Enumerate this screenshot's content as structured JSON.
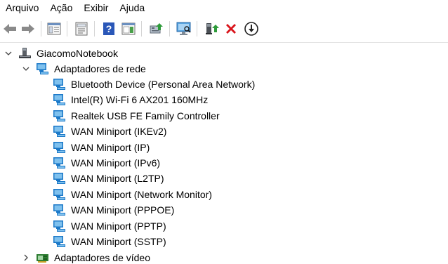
{
  "menu": {
    "items": [
      "Arquivo",
      "Ação",
      "Exibir",
      "Ajuda"
    ]
  },
  "toolbar": {
    "buttons": [
      {
        "icon": "back-arrow-icon"
      },
      {
        "icon": "forward-arrow-icon"
      },
      {
        "icon": "console-tree-icon"
      },
      {
        "icon": "properties-icon"
      },
      {
        "icon": "help-icon"
      },
      {
        "icon": "action-pane-icon"
      },
      {
        "icon": "update-driver-icon"
      },
      {
        "icon": "scan-hardware-icon"
      },
      {
        "icon": "enable-device-icon"
      },
      {
        "icon": "uninstall-device-icon"
      },
      {
        "icon": "download-icon"
      }
    ]
  },
  "tree": {
    "root": {
      "label": "GiacomoNotebook"
    },
    "category_network": {
      "label": "Adaptadores de rede"
    },
    "network_devices": [
      "Bluetooth Device (Personal Area Network)",
      "Intel(R) Wi-Fi 6 AX201 160MHz",
      "Realtek USB FE Family Controller",
      "WAN Miniport (IKEv2)",
      "WAN Miniport (IP)",
      "WAN Miniport (IPv6)",
      "WAN Miniport (L2TP)",
      "WAN Miniport (Network Monitor)",
      "WAN Miniport (PPPOE)",
      "WAN Miniport (PPTP)",
      "WAN Miniport (SSTP)"
    ],
    "category_video": {
      "label": "Adaptadores de vídeo"
    }
  },
  "colors": {
    "icon_blue": "#1c79c8",
    "icon_light": "#7fc1ee",
    "help_blue": "#2a57b8",
    "red_x": "#d9141b",
    "green": "#2e9b3a"
  }
}
